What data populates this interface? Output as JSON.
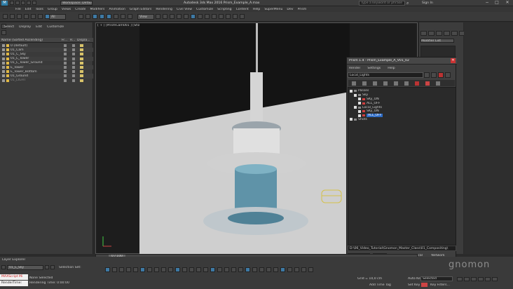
{
  "window": {
    "workspace": "Workspace: Default",
    "title": "Autodesk 3ds Max 2016   Prism_Example_A.max",
    "search_placeholder": "Type a keyword or phrase",
    "sign_in": "Sign In"
  },
  "menu": [
    "File",
    "Edit",
    "Tools",
    "Group",
    "Views",
    "Create",
    "Modifiers",
    "Animation",
    "Graph Editors",
    "Rendering",
    "Civil View",
    "Customize",
    "Scripting",
    "Content",
    "Help",
    "SuperMenu",
    "Dev",
    "Prism"
  ],
  "toolbar": {
    "filter_value": "All",
    "view_value": "View"
  },
  "scene_explorer": {
    "menu": [
      "Select",
      "Display",
      "Edit",
      "Customize"
    ],
    "columns": [
      "Name (Sorted Ascending)",
      "Fr...",
      "R...",
      "Displa..."
    ],
    "layers": [
      {
        "name": "0 (default)"
      },
      {
        "name": "01_Cam"
      },
      {
        "name": "01_C_Sky"
      },
      {
        "name": "01_L_Tower"
      },
      {
        "name": "01_L_Tower_Ground"
      },
      {
        "name": "E_Tower"
      },
      {
        "name": "E_Tower_Bottom"
      },
      {
        "name": "01_Ground"
      },
      {
        "name": "01_LIGHT"
      }
    ]
  },
  "viewport": {
    "label": "[ + ] [PrismCam001 ] [Shaded ]"
  },
  "prism": {
    "title": "Prism 1.4 - Prism_Example_A_V01_02",
    "menu": [
      "Render",
      "Settings",
      "Help"
    ],
    "field": "Local_Lights",
    "tree": [
      {
        "label": "Passes",
        "depth": 0
      },
      {
        "label": "Sky",
        "depth": 1
      },
      {
        "label": "SKy_ON",
        "depth": 2
      },
      {
        "label": "ALL_OFF",
        "depth": 2
      },
      {
        "label": "Local_Lights",
        "depth": 1
      },
      {
        "label": "SKy_ON",
        "depth": 2
      },
      {
        "label": "ALL_OFF",
        "depth": 2,
        "selected": true
      },
      {
        "label": "Shots",
        "depth": 0
      }
    ],
    "path": "D:\\06_Video_Tutorial\\Gnomon_Master_Class\\01_Compositing\\",
    "right_buttons": [
      "Local",
      "Network"
    ]
  },
  "command_panel": {
    "modifier_list": "Modifier List"
  },
  "timeline": {
    "frame": "0 / 100",
    "ticks": [
      "0",
      "5",
      "10",
      "15",
      "20",
      "25",
      "30",
      "35",
      "40",
      "45",
      "50",
      "55",
      "60",
      "65",
      "70",
      "75",
      "80",
      "85",
      "90",
      "95",
      "100"
    ]
  },
  "bottom": {
    "layer_explorer": "Layer Explorer",
    "layer_field": "01_L_Sky",
    "selection_set": "Selection Set:",
    "status1": "None Selected",
    "status2": "Rendering Time: 0:00:00",
    "maxscript": "MAXScript Mi",
    "renderer": "RenderTime:",
    "grid": "Grid = 10,0 cm",
    "add_time_tag": "Add Time Tag",
    "auto_key": "Auto Key",
    "set_key": "Set Key",
    "selected": "Selected",
    "key_filters": "Key Filters..."
  },
  "watermark": "gnomon"
}
